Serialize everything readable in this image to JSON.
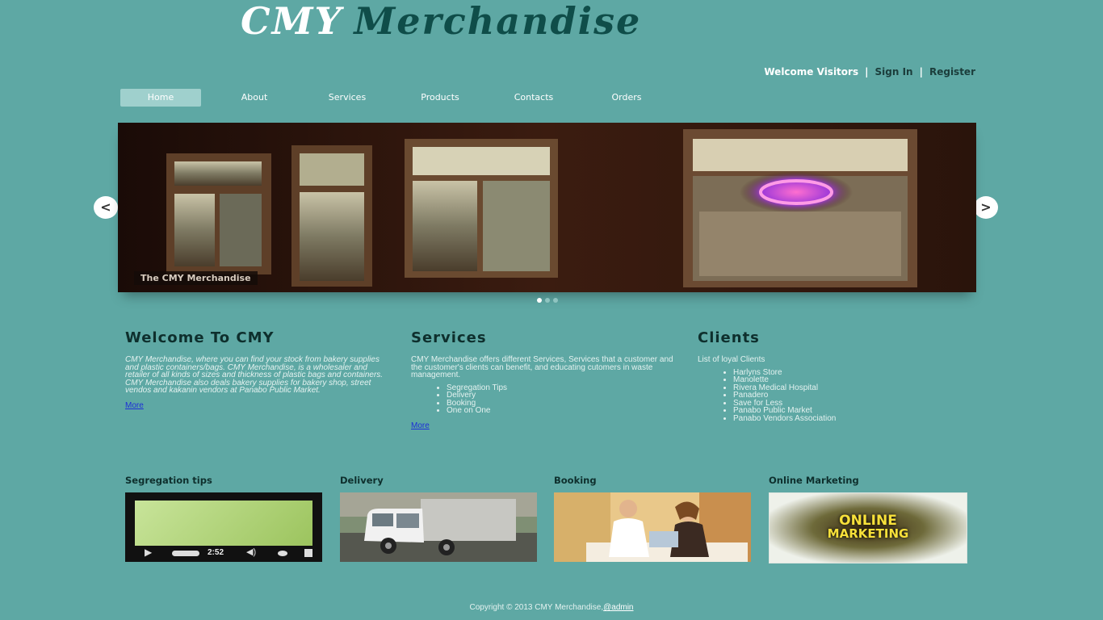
{
  "header": {
    "logo_part1": "CMY",
    "logo_part2": "Merchandise"
  },
  "userbar": {
    "welcome": "Welcome Visitors",
    "sep": "|",
    "sign_in": "Sign In",
    "register": "Register"
  },
  "nav": {
    "items": [
      {
        "label": "Home",
        "active": true
      },
      {
        "label": "About"
      },
      {
        "label": "Services"
      },
      {
        "label": "Products"
      },
      {
        "label": "Contacts"
      },
      {
        "label": "Orders"
      }
    ]
  },
  "slider": {
    "caption": "The CMY Merchandise",
    "prev": "<",
    "next": ">",
    "dot_count": 3,
    "active_dot": 1
  },
  "welcome": {
    "heading": "Welcome To CMY",
    "text": "CMY Merchandise, where you can find your stock from bakery supplies and plastic containers/bags. CMY Merchandise, is a wholesaler and retailer of all kinds of sizes and thickness of plastic bags and containers. CMY Merchandise also deals bakery supplies for bakery shop, street vendos and kakanin vendors at Panabo Public Market.",
    "more": "More"
  },
  "services": {
    "heading": "Services",
    "text": "CMY Merchandise offers different Services, Services that a customer and the customer's clients can benefit, and educating cutomers in waste management.",
    "items": [
      "Segregation Tips",
      "Delivery",
      "Booking",
      "One on One"
    ],
    "more": "More"
  },
  "clients": {
    "heading": "Clients",
    "intro": "List of loyal Clients",
    "items": [
      "Harlyns Store",
      "Manolette",
      "Rivera Medical Hospital",
      "Panadero",
      "Save for Less",
      "Panabo Public Market",
      "Panabo Vendors Association"
    ]
  },
  "tiles": [
    {
      "title": "Segregation tips",
      "video_time": "2:52"
    },
    {
      "title": "Delivery"
    },
    {
      "title": "Booking"
    },
    {
      "title": "Online Marketing",
      "image_text_1": "ONLINE",
      "image_text_2": "MARKETING"
    }
  ],
  "footer": {
    "copyright": "Copyright © 2013 CMY Merchandise,",
    "admin": "@admin"
  }
}
